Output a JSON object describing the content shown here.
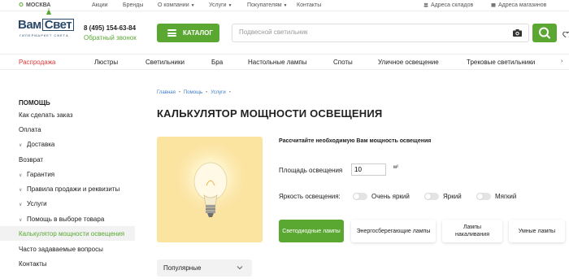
{
  "topbar": {
    "city": "МОСКВА",
    "links": [
      "Акции",
      "Бренды",
      "О компании",
      "Услуги",
      "Покупателям",
      "Контакты"
    ],
    "warehouses": "Адреса складов",
    "stores": "Адреса магазинов"
  },
  "header": {
    "logo_main": "Вам",
    "logo_box": "Свет",
    "logo_sub": "ГИПЕРМАРКЕТ СВЕТА",
    "phone": "8 (495) 154-63-84",
    "callback": "Обратный звонок",
    "catalog_label": "КАТАЛОГ",
    "search_placeholder": "Подвесной светильник"
  },
  "nav": [
    "Распродажа",
    "Люстры",
    "Светильники",
    "Бра",
    "Настольные лампы",
    "Споты",
    "Уличное освещение",
    "Трековые светильники"
  ],
  "sidebar": {
    "title": "ПОМОЩЬ",
    "items": [
      "Как сделать заказ",
      "Оплата",
      "Доставка",
      "Возврат",
      "Гарантия",
      "Правила продажи и реквизиты",
      "Услуги",
      "Помощь в выборе товара",
      "Калькулятор мощности освещения",
      "Часто задаваемые вопросы",
      "Контакты"
    ]
  },
  "breadcrumbs": [
    "Главная",
    "Помощь",
    "Услуги"
  ],
  "page_title": "КАЛЬКУЛЯТОР МОЩНОСТИ ОСВЕЩЕНИЯ",
  "calc": {
    "heading": "Рассчитайте необходимую Вам мощность освещения",
    "area_label": "Площадь освещения",
    "area_value": "10",
    "area_unit": "м²",
    "brightness_label": "Яркость освещения:",
    "brightness_options": [
      "Очень яркий",
      "Яркий",
      "Мягкий"
    ],
    "lamp_types": [
      "Светодиодные лампы",
      "Энергосберегающие лампы",
      "Лампы накаливания",
      "Умные лампы"
    ]
  },
  "sort": {
    "selected": "Популярные"
  },
  "colors": {
    "accent": "#5aa832",
    "sale": "#e03a3a",
    "link": "#3a7bc8",
    "brand": "#2b4a6b"
  }
}
